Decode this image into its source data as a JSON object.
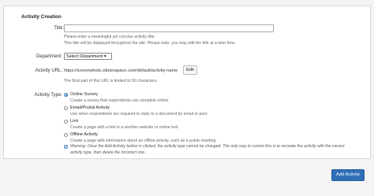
{
  "form": {
    "section_title": "Activity Creation",
    "title_label": "Title:",
    "title_value": "",
    "title_help_1": "Please enter a meaningful yet concise activity title.",
    "title_help_2": "This title will be displayed throughout the site. Please note, you may edit the title at a later time.",
    "department_label": "Department:",
    "department_selected": "Select Department ▾",
    "url_label": "Activity URL:",
    "url_prefix": "https://screenshots.citizenspace.com/default/activity-name",
    "edit_button": "Edit",
    "url_help": "The final part of this URL is limited to 50 characters.",
    "type_label": "Activity Type:",
    "types": [
      {
        "label": "Online Survey",
        "help": "Create a survey that respondents can complete online.",
        "selected": true
      },
      {
        "label": "Email/Postal Activity",
        "help": "Use when respondents are required to reply to a document by email or post.",
        "selected": false
      },
      {
        "label": "Link",
        "help": "Create a page with a link to a another website or online tool.",
        "selected": false
      },
      {
        "label": "Offline Activity",
        "help": "Create a page with information about an offline activity, such as a public meeting.",
        "selected": false
      }
    ],
    "warning_line_1": "Warning: Once the Add Activity button is clicked, the activity type cannot be changed. The only way to correct this is to recreate the activity with the correct",
    "warning_line_2": "activity type, then delete the incorrect one.",
    "warning_icon": "info-icon",
    "submit_button": "Add Activity",
    "accent_color": "#2f6fb8"
  }
}
